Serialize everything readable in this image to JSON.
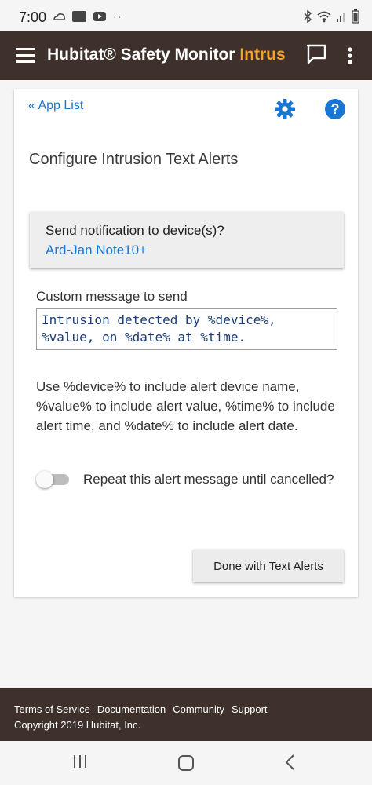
{
  "status_bar": {
    "time": "7:00",
    "left_icons": [
      "weather-icon",
      "app-icon",
      "youtube-icon",
      "more-dots-icon"
    ],
    "right_icons": [
      "bluetooth-icon",
      "wifi-icon",
      "signal-icon",
      "battery-icon"
    ]
  },
  "app_bar": {
    "title_main": "Hubitat® Safety Monitor",
    "title_accent": "Intrus",
    "accent_color": "#f4a22c",
    "background_color": "#3e302a"
  },
  "card": {
    "app_list_link": "« App List",
    "page_title": "Configure Intrusion Text Alerts",
    "notify": {
      "label": "Send notification to device(s)?",
      "value": "Ard-Jan Note10+"
    },
    "message": {
      "label": "Custom message to send",
      "value": "Intrusion detected by %device%, %value, on %date% at %time."
    },
    "help_text": "Use %device% to include alert device name, %value% to include alert value, %time% to include alert time, and %date% to include alert date.",
    "repeat_toggle": {
      "label": "Repeat this alert message until cancelled?",
      "checked": false
    },
    "done_button": "Done with Text Alerts"
  },
  "footer": {
    "links": [
      "Terms of Service",
      "Documentation",
      "Community",
      "Support"
    ],
    "copyright": "Copyright 2019 Hubitat, Inc."
  },
  "colors": {
    "link": "#1976d2",
    "message_text": "#1a3c74"
  }
}
